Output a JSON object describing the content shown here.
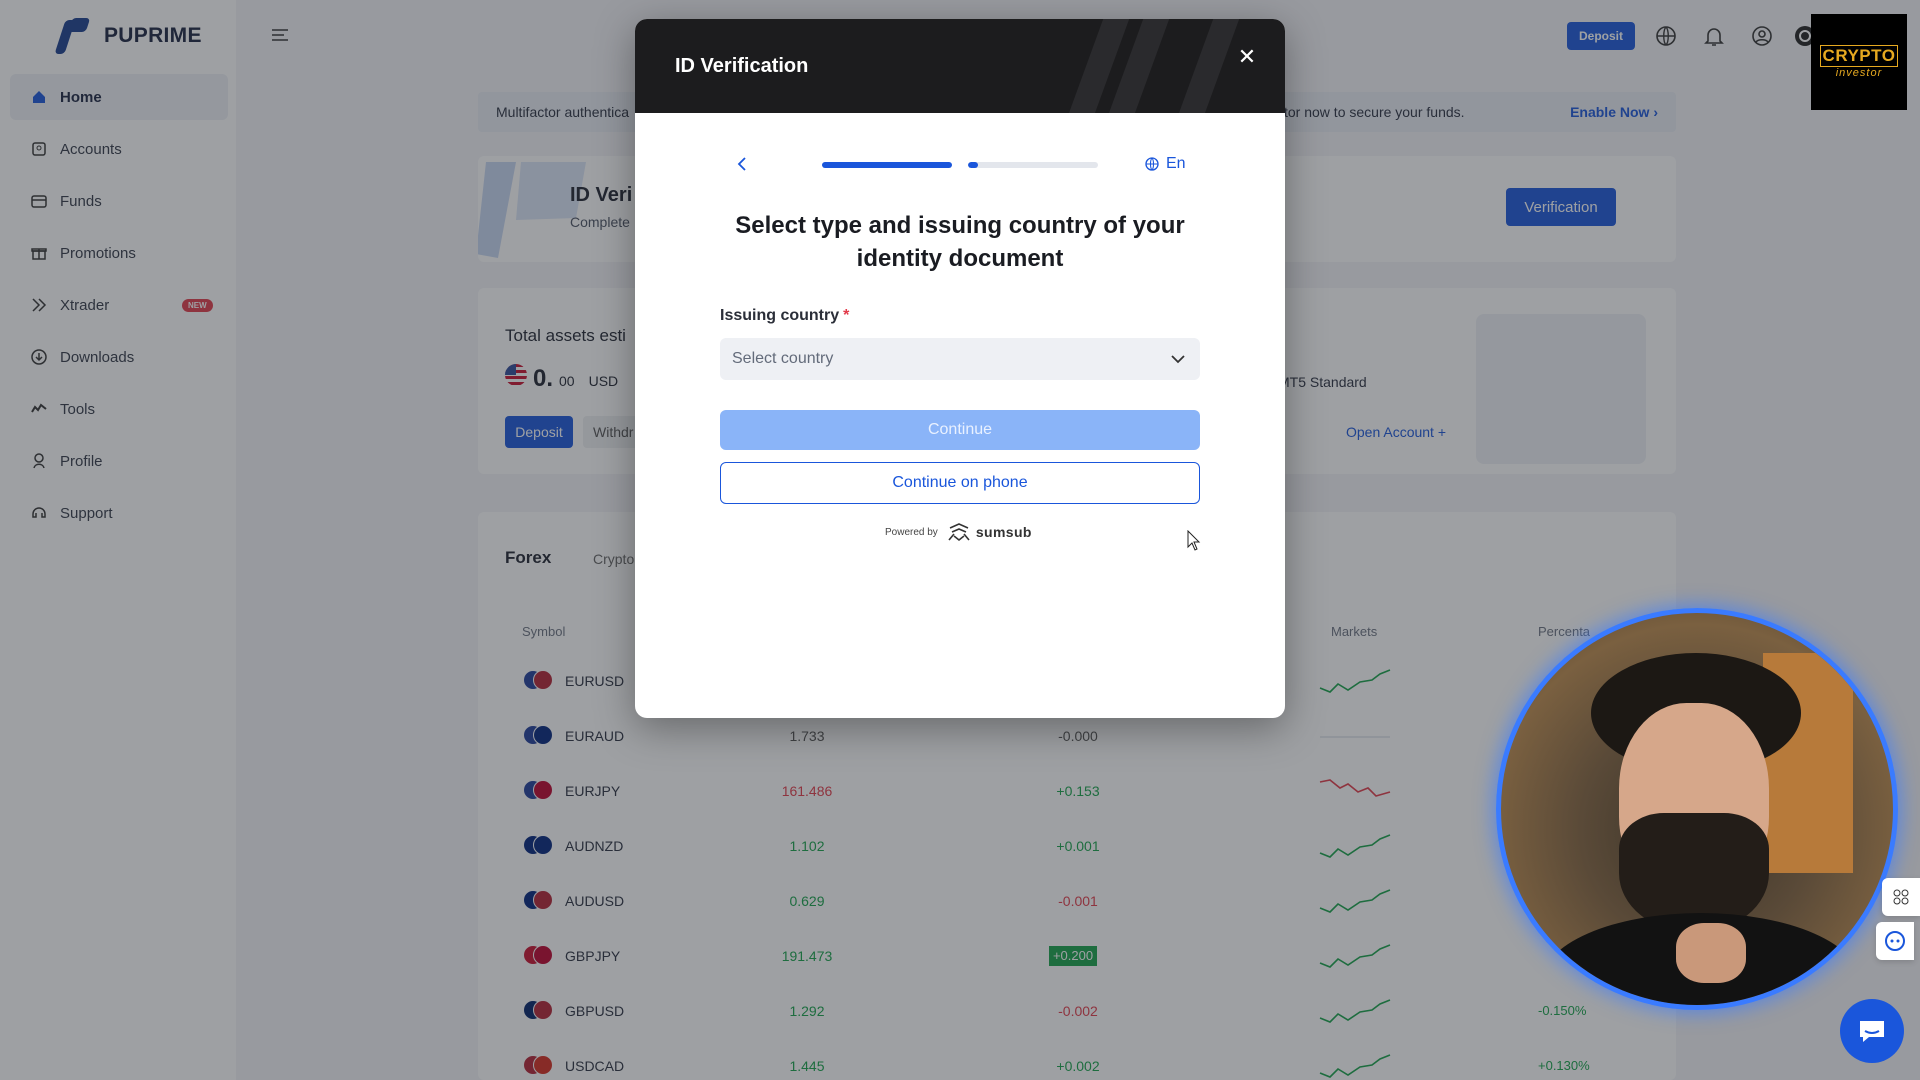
{
  "brand": {
    "name": "PUPRIME"
  },
  "sidebar": {
    "items": [
      {
        "label": "Home",
        "icon": "home-icon",
        "active": true
      },
      {
        "label": "Accounts",
        "icon": "accounts-icon"
      },
      {
        "label": "Funds",
        "icon": "funds-icon"
      },
      {
        "label": "Promotions",
        "icon": "gift-icon"
      },
      {
        "label": "Xtrader",
        "icon": "xtrader-icon",
        "badge": "NEW"
      },
      {
        "label": "Downloads",
        "icon": "download-icon"
      },
      {
        "label": "Tools",
        "icon": "tools-icon"
      },
      {
        "label": "Profile",
        "icon": "profile-icon"
      },
      {
        "label": "Support",
        "icon": "support-icon"
      }
    ]
  },
  "topbar": {
    "deposit_label": "Deposit"
  },
  "banner": {
    "left_text": "Multifactor authentica",
    "right_text": "tor now to secure your funds.",
    "enable_label": "Enable Now"
  },
  "id_card": {
    "title": "ID Veri",
    "subtitle": "Complete",
    "button_label": "Verification"
  },
  "assets": {
    "title": "Total assets esti",
    "value_int": "0.",
    "value_dec": "00",
    "currency": "USD",
    "deposit_label": "Deposit",
    "withdraw_label": "Withdr",
    "account_type": "MT5 Standard",
    "open_account_label": "Open Account +"
  },
  "market": {
    "tabs": [
      "Forex",
      "Crypto"
    ],
    "headers": {
      "symbol": "Symbol",
      "markets": "Markets",
      "percent": "Percenta"
    },
    "rows": [
      {
        "symbol": "EURUSD",
        "price": "",
        "change": "",
        "pct": "",
        "trend": "up",
        "color": "pos"
      },
      {
        "symbol": "EURAUD",
        "price": "1.733",
        "change": "-0.000",
        "pct": "",
        "trend": "flat",
        "color": "neu"
      },
      {
        "symbol": "EURJPY",
        "price": "161.486",
        "change": "+0.153",
        "pct": "",
        "trend": "down",
        "color": "neg"
      },
      {
        "symbol": "AUDNZD",
        "price": "1.102",
        "change": "+0.001",
        "pct": "",
        "trend": "up",
        "color": "pos"
      },
      {
        "symbol": "AUDUSD",
        "price": "0.629",
        "change": "-0.001",
        "pct": "",
        "trend": "up",
        "color": "pos"
      },
      {
        "symbol": "GBPJPY",
        "price": "191.473",
        "change": "+0.200",
        "pct": "",
        "trend": "up",
        "color": "pos",
        "highlight": true
      },
      {
        "symbol": "GBPUSD",
        "price": "1.292",
        "change": "-0.002",
        "pct": "-0.150%",
        "trend": "up",
        "color": "pos"
      },
      {
        "symbol": "USDCAD",
        "price": "1.445",
        "change": "+0.002",
        "pct": "+0.130%",
        "trend": "up",
        "color": "pos"
      }
    ]
  },
  "modal": {
    "title": "ID Verification",
    "language": "En",
    "heading": "Select type and issuing country of your identity document",
    "field_label": "Issuing country",
    "required_mark": "*",
    "select_placeholder": "Select country",
    "continue_label": "Continue",
    "phone_label": "Continue on phone",
    "powered_by": "Powered by",
    "provider": "sumsub",
    "progress": {
      "step1": 1.0,
      "step2": 0.08
    }
  },
  "overlay_logo": {
    "top": "CRYPTO",
    "bottom": "investor"
  },
  "colors": {
    "accent": "#1a56db",
    "positive": "#16a34a",
    "negative": "#e23b4a"
  }
}
